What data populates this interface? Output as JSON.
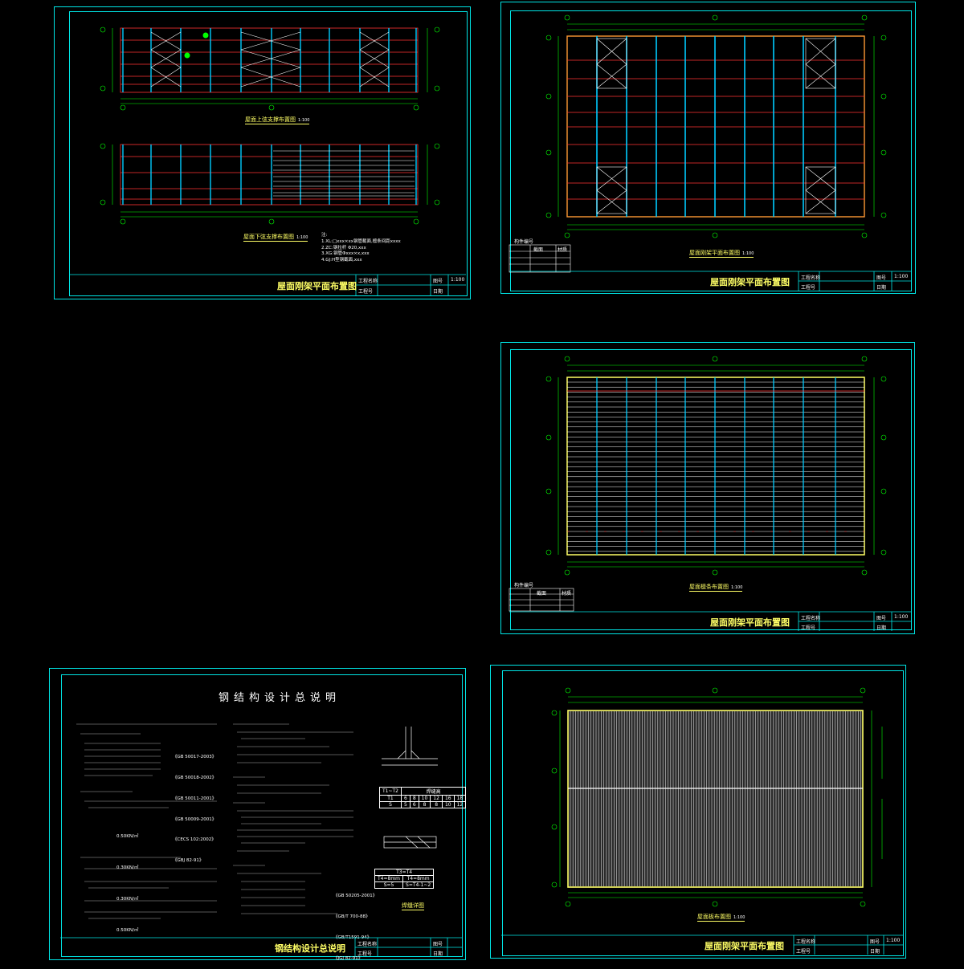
{
  "sheets": {
    "s1": {
      "title": "屋面刚架平面布置图",
      "captions": [
        "屋面上弦支撑布置图",
        "屋面下弦支撑布置图"
      ],
      "scales": [
        "1:100",
        "1:100"
      ],
      "notes": "注:\n1.XL:□xxx×xx钢管截面,檩条间距xxxx\n2.ZC:钢拉杆 Φ20,xxx\n3.XG:钢管Φxxx×x,xxx\n4.GJ:H型钢截面,xxx"
    },
    "s2": {
      "title": "屋面刚架平面布置图",
      "caption": "屋面刚架平面布置图",
      "scale": "1:100",
      "legend": [
        "构件编号",
        "截面",
        "材质"
      ]
    },
    "s3": {
      "title": "屋面刚架平面布置图",
      "caption": "屋面檩条布置图",
      "scale": "1:100",
      "legend": [
        "构件编号",
        "截面",
        "材质"
      ]
    },
    "s4": {
      "title": "钢结构设计总说明",
      "heading": "钢结构设计总说明",
      "codes": [
        "《GB 50017-2003》",
        "《GB 50018-2002》",
        "《GB 50011-2001》",
        "《GB 50009-2001》",
        "《CECS 102:2002》",
        "《GBJ 82-91》",
        "《GB 50205-2001》",
        "《GB/T 700-88》",
        "《GB/T1591-94》",
        "《JGJ 82-91》"
      ],
      "loads": [
        "0.50KN/㎡",
        "0.30KN/㎡",
        "0.30KN/㎡",
        "0.50KN/㎡"
      ],
      "table_header": [
        "T1~T2",
        "焊缝高"
      ],
      "table_rows": [
        [
          "T1",
          "6",
          "8",
          "10",
          "12",
          "16",
          "18"
        ],
        [
          "S",
          "5",
          "6",
          "8",
          "8",
          "10",
          "12"
        ]
      ],
      "weld_label": "T3=T4",
      "weld_rows": [
        "T4=8mm",
        "T4=8mm",
        "S=5",
        "S=T4-1~2"
      ],
      "weld_caption": "焊缝详图"
    },
    "s5": {
      "title": "屋面刚架平面布置图",
      "caption": "屋面板布置图",
      "scale": "1:100"
    }
  },
  "common": {
    "tb_labels": [
      "工程名称",
      "工程号",
      "图号",
      "日期",
      "比例"
    ],
    "scale_value": "1:100"
  },
  "colors": {
    "frame": "#00e5e5",
    "axis": "#00ff00",
    "purlin": "#ff3333",
    "beam": "#00ccff",
    "title": "#ffff66",
    "edge": "#ff9933"
  }
}
